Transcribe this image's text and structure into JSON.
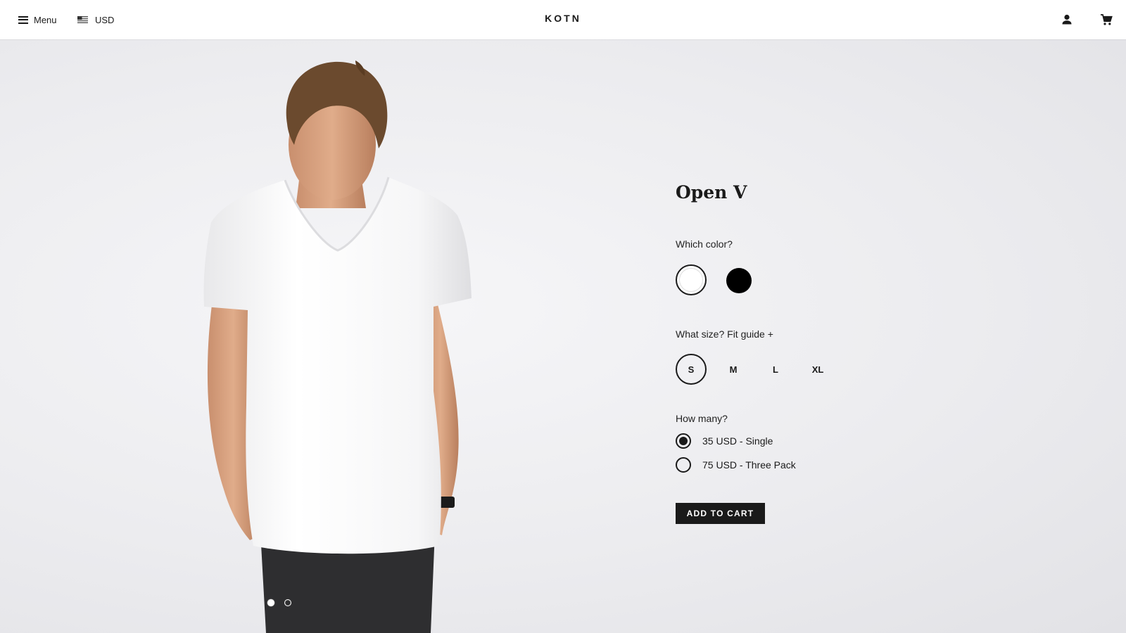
{
  "header": {
    "menu_label": "Menu",
    "currency_label": "USD",
    "logo": "KOTN",
    "icons": [
      "menu-icon",
      "us-flag-icon",
      "account-icon",
      "cart-icon"
    ]
  },
  "product": {
    "title": "Open V",
    "color_prompt": "Which color?",
    "colors": [
      {
        "name": "white",
        "hex": "#ffffff",
        "selected": true
      },
      {
        "name": "black",
        "hex": "#000000",
        "selected": false
      }
    ],
    "size_prompt": "What size?",
    "fit_guide": "Fit guide +",
    "sizes": [
      "S",
      "M",
      "L",
      "XL"
    ],
    "selected_size": "S",
    "qty_prompt": "How many?",
    "options": [
      {
        "label": "35 USD - Single",
        "selected": true
      },
      {
        "label": "75 USD - Three Pack",
        "selected": false
      }
    ],
    "add_to_cart": "ADD TO CART"
  },
  "gallery": {
    "slides": 2,
    "active_slide": 1
  },
  "colors": {
    "text": "#1a1a1a",
    "background": "#e9e9ec",
    "button": "#1a1a1a"
  }
}
